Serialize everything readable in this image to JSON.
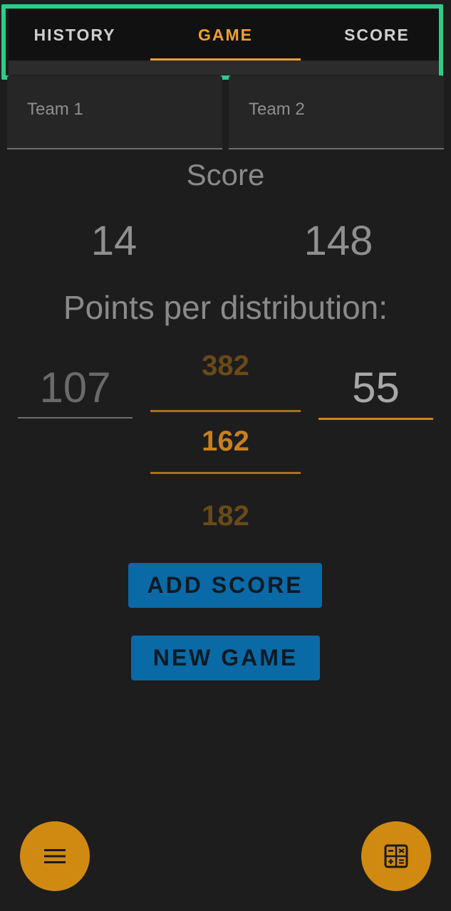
{
  "tabs": {
    "history": "HISTORY",
    "game": "GAME",
    "score": "SCORE"
  },
  "teams": {
    "team1_label": "Team 1",
    "team2_label": "Team 2"
  },
  "score": {
    "title": "Score",
    "team1": "14",
    "team2": "148"
  },
  "distribution": {
    "title": "Points per distribution:",
    "team1_value": "107",
    "team2_value": "55",
    "picker": {
      "above": "382",
      "selected": "162",
      "below": "182"
    }
  },
  "buttons": {
    "add_score": "ADD SCORE",
    "new_game": "NEW GAME"
  },
  "fabs": {
    "menu_icon": "menu-icon",
    "calculator_icon": "calculator-icon"
  },
  "colors": {
    "accent": "#f0a030",
    "button": "#0a6aa6",
    "fab": "#d08a12"
  }
}
